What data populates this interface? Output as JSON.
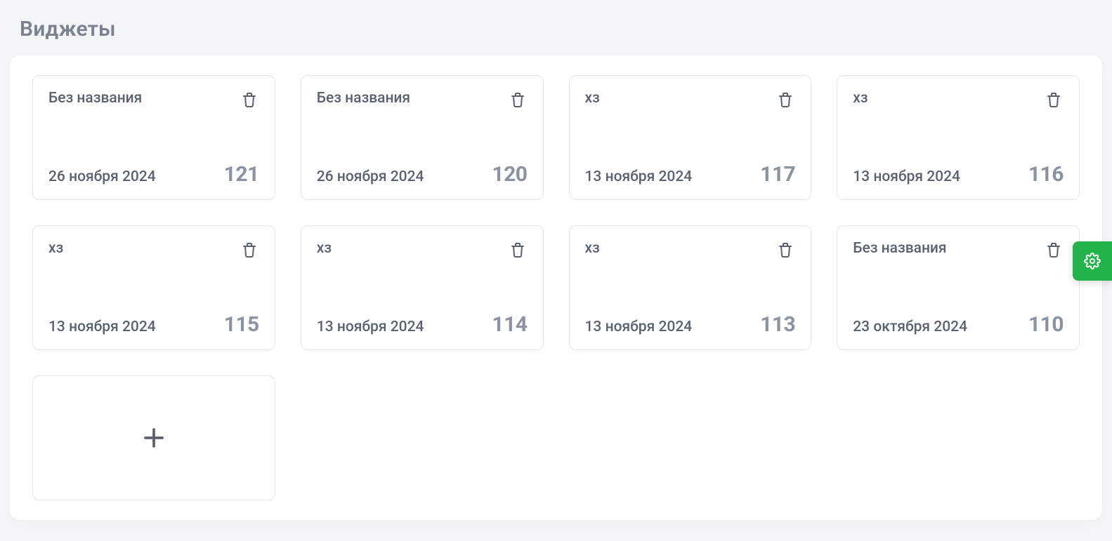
{
  "page_title": "Виджеты",
  "widgets": [
    {
      "title": "Без названия",
      "date": "26 ноября 2024",
      "num": "121"
    },
    {
      "title": "Без названия",
      "date": "26 ноября 2024",
      "num": "120"
    },
    {
      "title": "хз",
      "date": "13 ноября 2024",
      "num": "117"
    },
    {
      "title": "хз",
      "date": "13 ноября 2024",
      "num": "116"
    },
    {
      "title": "хз",
      "date": "13 ноября 2024",
      "num": "115"
    },
    {
      "title": "хз",
      "date": "13 ноября 2024",
      "num": "114"
    },
    {
      "title": "хз",
      "date": "13 ноября 2024",
      "num": "113"
    },
    {
      "title": "Без названия",
      "date": "23 октября 2024",
      "num": "110"
    }
  ]
}
